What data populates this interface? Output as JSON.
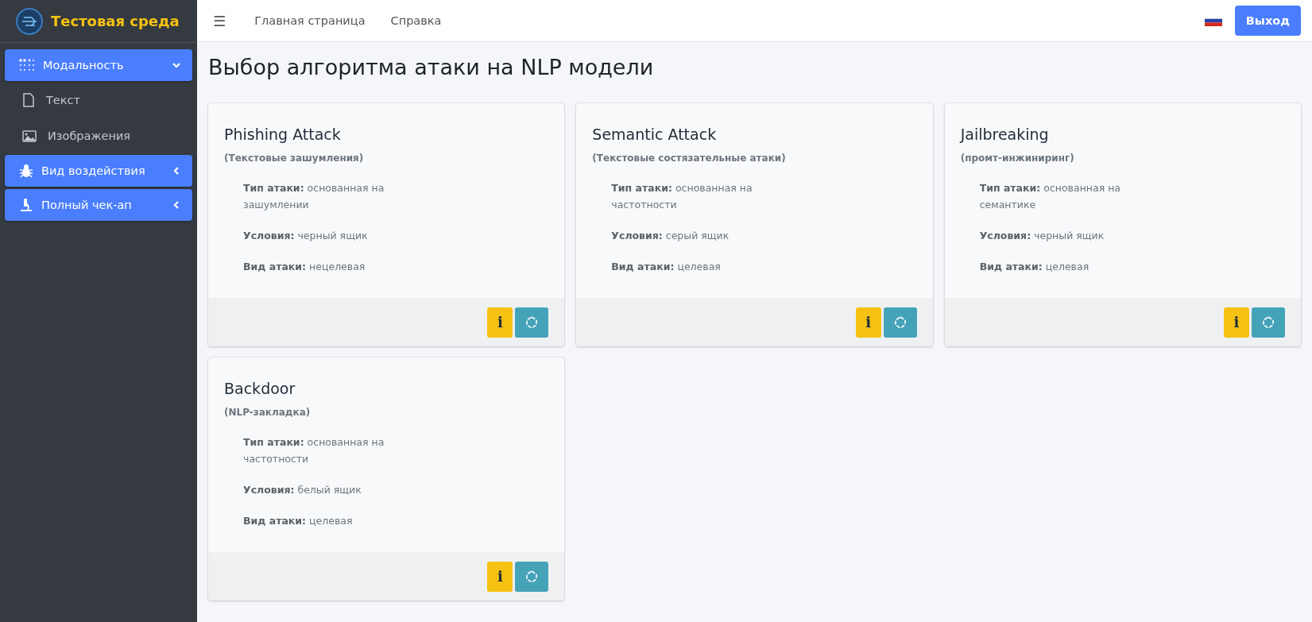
{
  "brand": {
    "title": "Тестовая среда"
  },
  "sidebar": {
    "items": [
      {
        "label": "Модальность",
        "expanded": true,
        "children": [
          {
            "label": "Текст"
          },
          {
            "label": "Изображения"
          }
        ]
      },
      {
        "label": "Вид воздействия",
        "expanded": false
      },
      {
        "label": "Полный чек-ап",
        "expanded": false
      }
    ]
  },
  "topbar": {
    "menu_icon": "☰",
    "links": [
      "Главная страница",
      "Справка"
    ],
    "logout": "Выход"
  },
  "page_title": "Выбор алгоритма атаки на NLP модели",
  "cards": [
    {
      "title": "Phishing Attack",
      "subtitle": "(Текстовые зашумления)",
      "properties": [
        "**Тип атаки:** основанная на зашумлении",
        "**Условия:** черный ящик",
        "**Вид атаки:** нецелевая"
      ],
      "info_button": "i"
    },
    {
      "title": "Semantic Attack",
      "subtitle": "(Текстовые состязательные атаки)",
      "properties": [
        "**Тип атаки:** основанная на частотности",
        "**Условия:** серый ящик",
        "**Вид атаки:** целевая"
      ],
      "info_button": "i"
    },
    {
      "title": "Jailbreaking",
      "subtitle": "(промт-инжиниринг)",
      "properties": [
        "**Тип атаки:** основанная на семантике",
        "**Условия:** черный ящик",
        "**Вид атаки:** целевая"
      ],
      "info_button": "i"
    },
    {
      "title": "Backdoor",
      "subtitle": "(NLP-закладка)",
      "properties": [
        "**Тип атаки:** основанная на частотности",
        "**Условия:** белый ящик",
        "**Вид атаки:** целевая"
      ],
      "info_button": "i"
    }
  ]
}
